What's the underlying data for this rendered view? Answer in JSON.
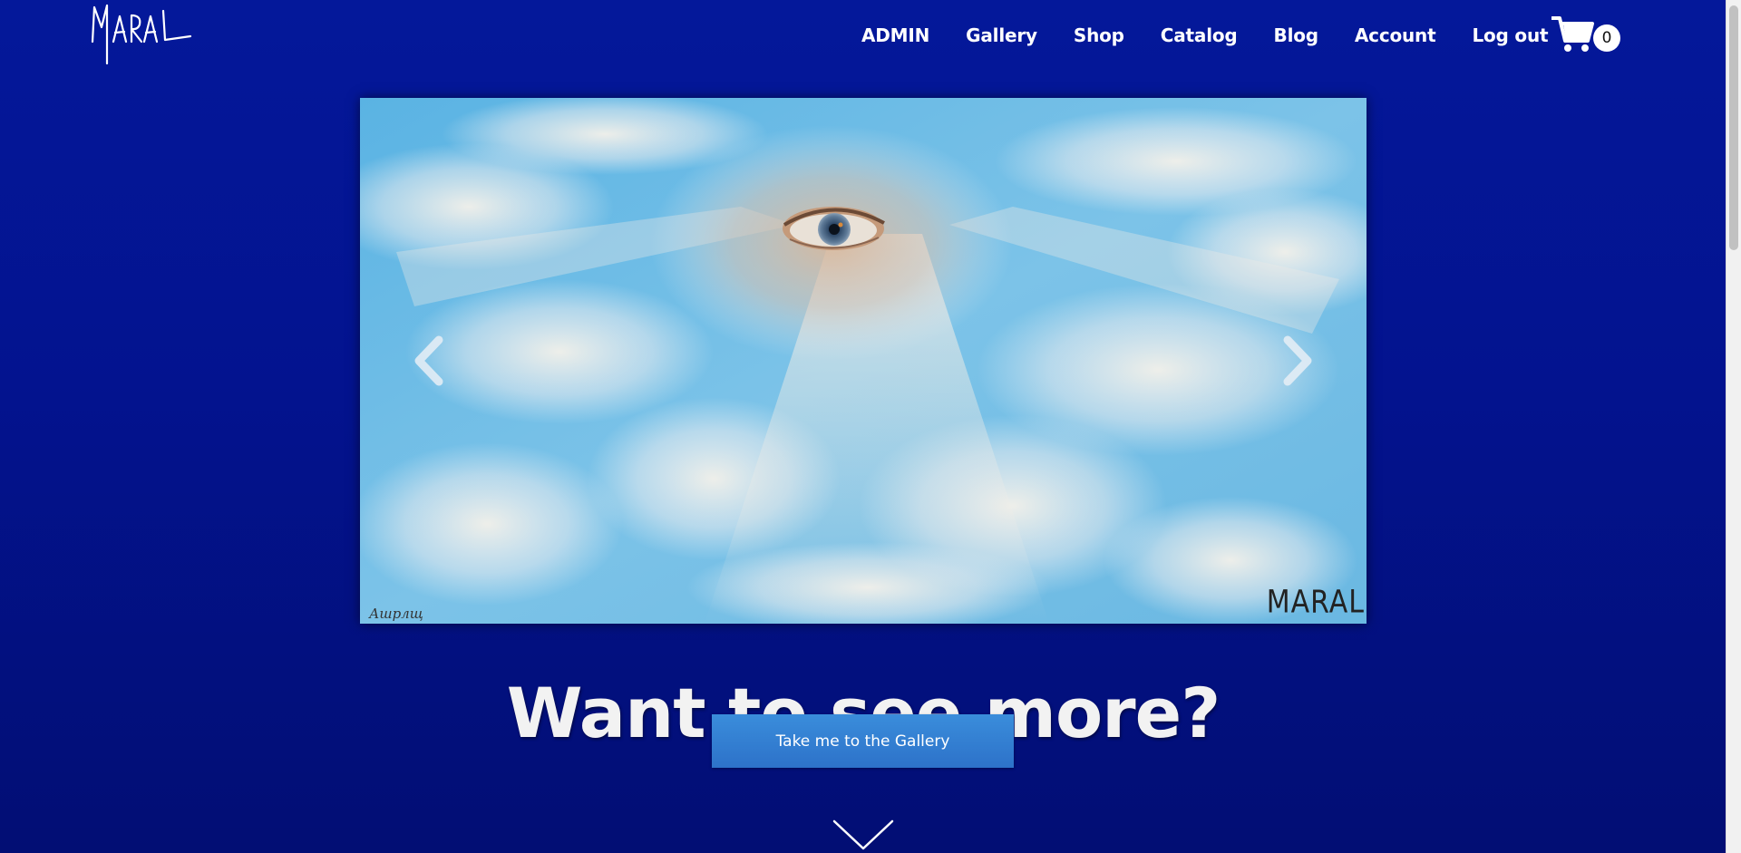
{
  "brand": {
    "logo_text": "MARAL"
  },
  "nav": {
    "items": [
      {
        "label": "ADMIN"
      },
      {
        "label": "Gallery"
      },
      {
        "label": "Shop"
      },
      {
        "label": "Catalog"
      },
      {
        "label": "Blog"
      },
      {
        "label": "Account"
      },
      {
        "label": "Log out"
      }
    ],
    "cart": {
      "icon": "cart-icon",
      "count": "0"
    }
  },
  "carousel": {
    "prev_icon": "chevron-left-icon",
    "next_icon": "chevron-right-icon",
    "painting": {
      "signature": "MARAL",
      "signature_left": "Ашрлщ"
    }
  },
  "cta": {
    "headline": "Want to see more?",
    "button_label": "Take me to the Gallery",
    "scroll_icon": "chevron-down-icon"
  },
  "colors": {
    "background": "#04189a",
    "button": "#3380d4",
    "text": "#ffffff"
  }
}
